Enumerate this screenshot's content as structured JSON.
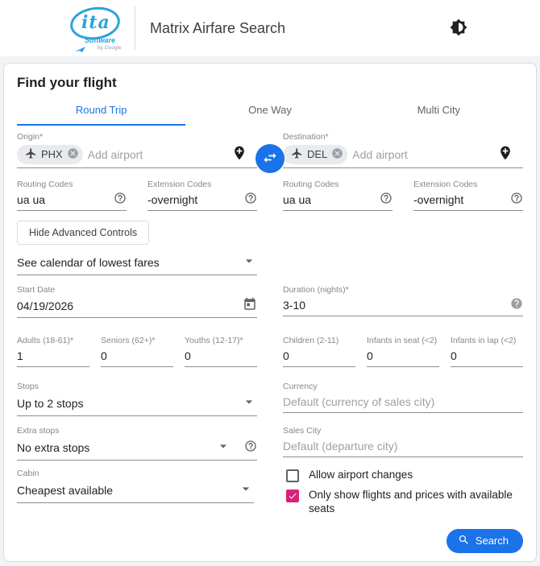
{
  "colors": {
    "accent_blue": "#1a73e8",
    "checkbox_pink": "#d6247a",
    "logo_blue": "#2ba3dc",
    "chip_bg": "#e8eaed"
  },
  "header": {
    "title": "Matrix Airfare Search",
    "logo": {
      "ita": "ita",
      "software": "Software",
      "by_google": "by Google"
    },
    "theme_toggle_icon": "brightness-medium-icon"
  },
  "search_form": {
    "heading": "Find your flight",
    "tabs": [
      {
        "label": "Round Trip",
        "active": true
      },
      {
        "label": "One Way",
        "active": false
      },
      {
        "label": "Multi City",
        "active": false
      }
    ],
    "origin": {
      "label": "Origin*",
      "airport_chip": "PHX",
      "placeholder": "Add airport"
    },
    "destination": {
      "label": "Destination*",
      "airport_chip": "DEL",
      "placeholder": "Add airport"
    },
    "routing": {
      "outbound": {
        "routing_label": "Routing Codes",
        "routing_value": "ua ua",
        "extension_label": "Extension Codes",
        "extension_value": "-overnight"
      },
      "return": {
        "routing_label": "Routing Codes",
        "routing_value": "ua ua",
        "extension_label": "Extension Codes",
        "extension_value": "-overnight"
      }
    },
    "advanced_controls_button": "Hide Advanced Controls",
    "calendar_select": {
      "value": "See calendar of lowest fares"
    },
    "start_date": {
      "label": "Start Date",
      "value": "04/19/2026"
    },
    "duration": {
      "label": "Duration (nights)*",
      "value": "3-10"
    },
    "passengers": [
      {
        "label": "Adults (18-61)*",
        "value": "1"
      },
      {
        "label": "Seniors (62+)*",
        "value": "0"
      },
      {
        "label": "Youths (12-17)*",
        "value": "0"
      },
      {
        "label": "Children (2-11)",
        "value": "0"
      },
      {
        "label": "Infants in seat (<2)",
        "value": "0"
      },
      {
        "label": "Infants in lap (<2)",
        "value": "0"
      }
    ],
    "stops": {
      "label": "Stops",
      "value": "Up to 2 stops"
    },
    "currency": {
      "label": "Currency",
      "placeholder": "Default (currency of sales city)"
    },
    "extra_stops": {
      "label": "Extra stops",
      "value": "No extra stops"
    },
    "sales_city": {
      "label": "Sales City",
      "placeholder": "Default (departure city)"
    },
    "cabin": {
      "label": "Cabin",
      "value": "Cheapest available"
    },
    "checkboxes": [
      {
        "label": "Allow airport changes",
        "checked": false
      },
      {
        "label": "Only show flights and prices with available seats",
        "checked": true
      }
    ],
    "search_button": "Search"
  }
}
